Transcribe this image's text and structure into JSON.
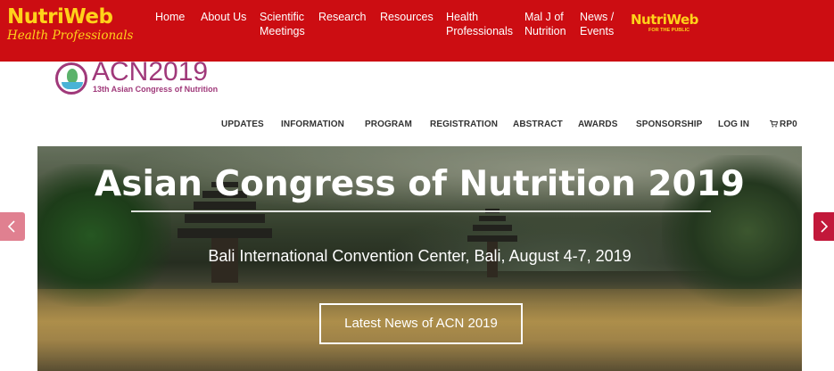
{
  "topnav": {
    "logo_main": "NutriWeb",
    "logo_sub": "Health Professionals",
    "items": [
      {
        "label": "Home"
      },
      {
        "label": "About Us"
      },
      {
        "label": "Scientific Meetings"
      },
      {
        "label": "Research"
      },
      {
        "label": "Resources"
      },
      {
        "label": "Health Professionals"
      },
      {
        "label": "Mal J of Nutrition"
      },
      {
        "label": "News / Events"
      }
    ],
    "public_logo_main": "NutriWeb",
    "public_logo_sub": "FOR THE PUBLIC"
  },
  "acn": {
    "title": "ACN2019",
    "subtitle": "13th Asian Congress of Nutrition"
  },
  "subnav": {
    "items": [
      {
        "label": "UPDATES"
      },
      {
        "label": "INFORMATION"
      },
      {
        "label": "PROGRAM"
      },
      {
        "label": "REGISTRATION"
      },
      {
        "label": "ABSTRACT"
      },
      {
        "label": "AWARDS"
      },
      {
        "label": "SPONSORSHIP"
      },
      {
        "label": "LOG IN"
      },
      {
        "label": "RP0",
        "icon": "cart-icon"
      }
    ]
  },
  "hero": {
    "title": "Asian Congress of Nutrition 2019",
    "subtitle": "Bali International Convention Center, Bali, August 4-7, 2019",
    "button_label": "Latest News of ACN 2019"
  },
  "colors": {
    "brand_red": "#cc0d12",
    "brand_yellow": "#ffd21a",
    "acn_purple": "#a0397a"
  }
}
